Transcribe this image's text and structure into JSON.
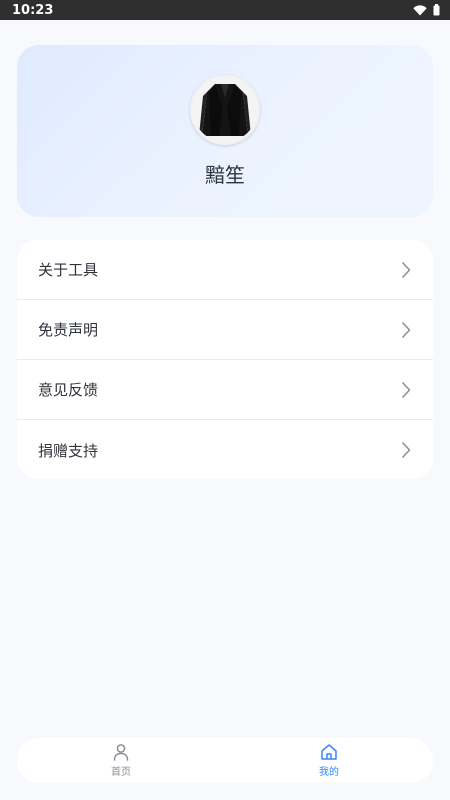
{
  "status_bar": {
    "time": "10:23",
    "icons": [
      "wifi-icon",
      "battery-icon"
    ]
  },
  "profile": {
    "avatar_icon": "suit-jacket-avatar",
    "name": "黯笙"
  },
  "menu": {
    "items": [
      {
        "label": "关于工具",
        "icon": "chevron-right-icon"
      },
      {
        "label": "免责声明",
        "icon": "chevron-right-icon"
      },
      {
        "label": "意见反馈",
        "icon": "chevron-right-icon"
      },
      {
        "label": "捐赠支持",
        "icon": "chevron-right-icon"
      }
    ]
  },
  "tab_bar": {
    "tabs": [
      {
        "label": "首页",
        "icon": "person-icon",
        "active": false
      },
      {
        "label": "我的",
        "icon": "home-icon",
        "active": true
      }
    ],
    "active_color": "#3b86f7",
    "inactive_color": "#8a8f98"
  }
}
